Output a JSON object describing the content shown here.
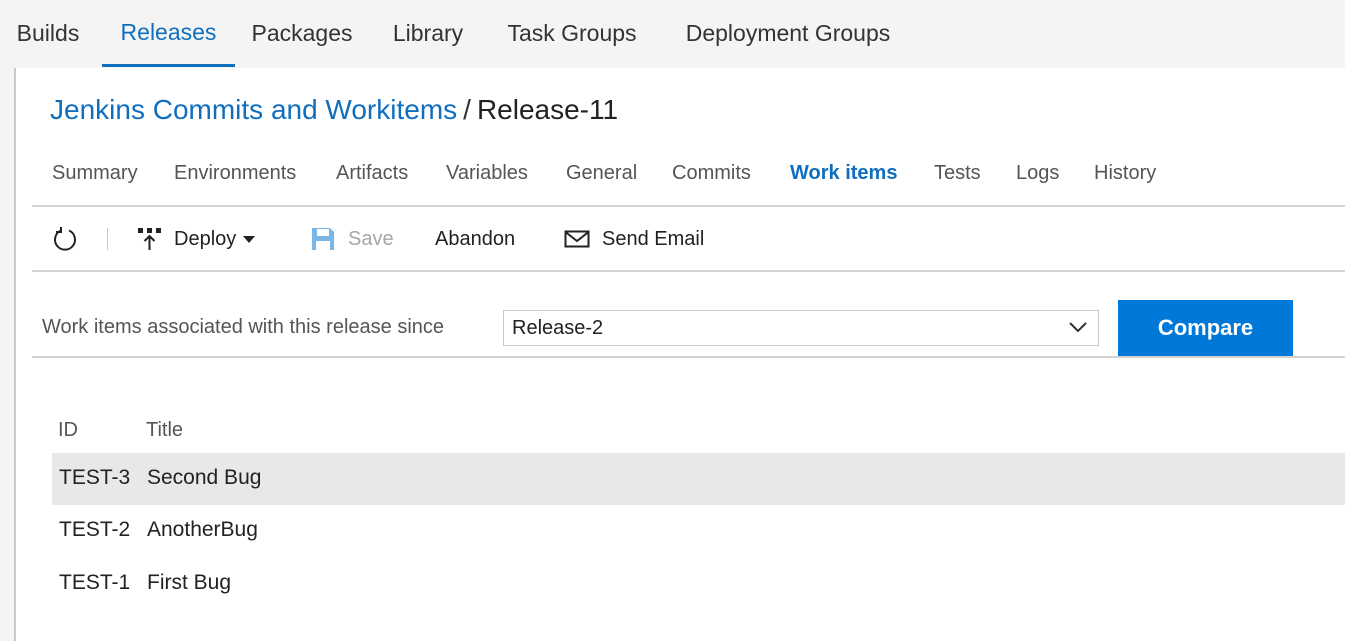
{
  "hub_tabs": [
    {
      "label": "Builds",
      "active": false
    },
    {
      "label": "Releases",
      "active": true
    },
    {
      "label": "Packages",
      "active": false
    },
    {
      "label": "Library",
      "active": false
    },
    {
      "label": "Task Groups",
      "active": false
    },
    {
      "label": "Deployment Groups",
      "active": false
    }
  ],
  "breadcrumb": {
    "definition": "Jenkins Commits and Workitems",
    "separator": "/",
    "release": "Release-11"
  },
  "release_tabs": [
    {
      "label": "Summary"
    },
    {
      "label": "Environments"
    },
    {
      "label": "Artifacts"
    },
    {
      "label": "Variables"
    },
    {
      "label": "General"
    },
    {
      "label": "Commits"
    },
    {
      "label": "Work items",
      "active": true
    },
    {
      "label": "Tests"
    },
    {
      "label": "Logs"
    },
    {
      "label": "History"
    }
  ],
  "toolbar": {
    "refresh_icon": "refresh-icon",
    "deploy_label": "Deploy",
    "save_label": "Save",
    "save_enabled": false,
    "abandon_label": "Abandon",
    "send_email_label": "Send Email"
  },
  "filter": {
    "label": "Work items associated with this release since",
    "selected": "Release-2",
    "compare_label": "Compare"
  },
  "table": {
    "columns": [
      "ID",
      "Title"
    ],
    "rows": [
      {
        "id": "TEST-3",
        "title": "Second Bug",
        "selected": true
      },
      {
        "id": "TEST-2",
        "title": "AnotherBug",
        "selected": false
      },
      {
        "id": "TEST-1",
        "title": "First Bug",
        "selected": false
      }
    ]
  },
  "colors": {
    "accent": "#106ebe",
    "primary_button": "#0078d7",
    "selected_row": "#e8e8e8"
  }
}
